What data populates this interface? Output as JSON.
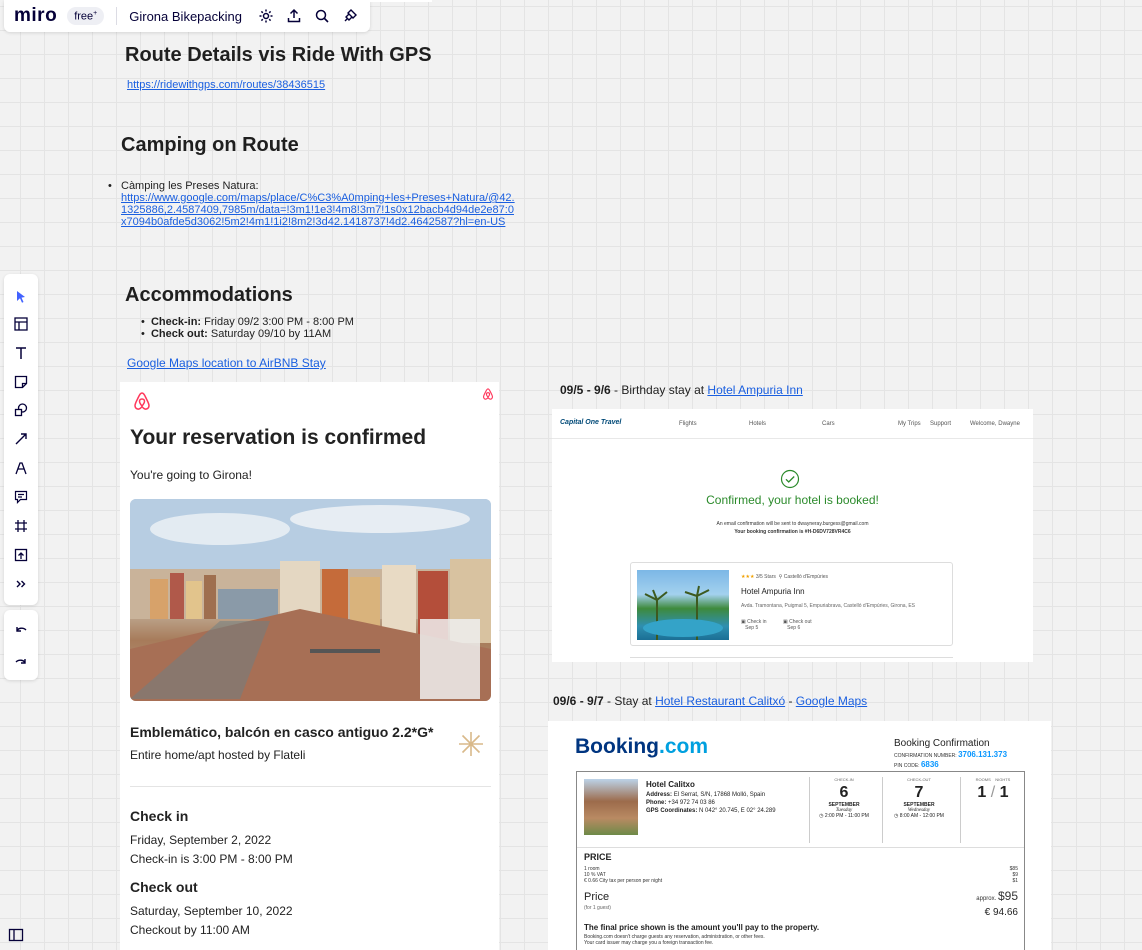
{
  "app": {
    "logo": "miro",
    "plan_badge": "free",
    "board_name": "Girona Bikepacking"
  },
  "board": {
    "route_title": "Route Details vis Ride With GPS",
    "route_link": "https://ridewithgps.com/routes/38436515",
    "camping_title": "Camping on Route",
    "camping_item_name": "Càmping les Preses Natura:",
    "camping_link_lines": [
      "https://www.google.com/maps/place/C%C3%A0mping+les+Preses+Natura/@42.",
      "1325886,2.4587409,7985m/data=!3m1!1e3!4m8!3m7!1s0x12bacb4d94de2e87:0",
      "x7094b0afde5d3062!5m2!4m1!1i2!8m2!3d42.1418737!4d2.4642587?hl=en-US"
    ],
    "accommodations_title": "Accommodations",
    "checkin_label": "Check-in:",
    "checkin_value": "Friday 09/2 3:00 PM - 8:00 PM",
    "checkout_label": "Check out:",
    "checkout_value": "Saturday 09/10 by 11AM",
    "maps_link": "Google Maps location to AirBNB Stay"
  },
  "airbnb": {
    "title": "Your reservation is confirmed",
    "subtitle": "You're going to Girona!",
    "listing": "Emblemático, balcón en casco antiguo 2.2*G*",
    "host": "Entire home/apt hosted by Flateli",
    "checkin_h": "Check in",
    "checkin_date": "Friday, September 2, 2022",
    "checkin_time": "Check-in is 3:00 PM - 8:00 PM",
    "checkout_h": "Check out",
    "checkout_date": "Saturday, September 10, 2022",
    "checkout_time": "Checkout by 11:00 AM"
  },
  "stay1": {
    "dates": "09/5 - 9/6",
    "text": " - Birthday stay at ",
    "link": "Hotel Ampuria Inn"
  },
  "capitalone": {
    "logo": "Capital One Travel",
    "nav": [
      "Flights",
      "Hotels",
      "Cars"
    ],
    "nav_right": [
      "My Trips",
      "Support",
      "Welcome, Dwayne"
    ],
    "title": "Confirmed, your hotel is booked!",
    "email_note": "An email confirmation will be sent to dwayneray.burgess@gmail.com",
    "conf_note": "Your booking confirmation is #H-D6DV728VR4C6",
    "stars": "3/5 Stars",
    "location": "Castelló d'Empúries",
    "hotel": "Hotel Ampuria Inn",
    "address": "Avda. Tramontana, Puigmal 5, Empuriabrava, Castelló d'Empúries, Girona, ES",
    "checkin_label": "Check in",
    "checkin": "Sep 5",
    "checkout_label": "Check out",
    "checkout": "Sep 6"
  },
  "stay2": {
    "dates": "09/6 - 9/7",
    "text": " - Stay at ",
    "link": "Hotel Restaurant Calitxó",
    "sep": " - ",
    "link2": "Google Maps"
  },
  "booking": {
    "logo_main": "Booking",
    "logo_dot": ".com",
    "heading": "Booking Confirmation",
    "conf_label": "CONFIRMATION NUMBER:",
    "conf_number": "3706.131.373",
    "pin_label": "PIN CODE:",
    "pin": "6836",
    "hotel": "Hotel Calitxo",
    "address_label": "Address:",
    "address": "El Serrat, S/N, 17868 Molló, Spain",
    "phone_label": "Phone:",
    "phone": "+34 972 74 03 86",
    "gps_label": "GPS Coordinates:",
    "gps": "N 042° 20.745, E 02° 24.289",
    "checkin_cap": "CHECK-IN",
    "checkin_day": "6",
    "checkin_month": "SEPTEMBER",
    "checkin_dow": "Tuesday",
    "checkin_time": "2:00 PM - 11:00 PM",
    "checkout_cap": "CHECK-OUT",
    "checkout_day": "7",
    "checkout_month": "SEPTEMBER",
    "checkout_dow": "Wednesday",
    "checkout_time": "8:00 AM - 12:00 PM",
    "rooms_cap": "ROOMS",
    "nights_cap": "NIGHTS",
    "rooms": "1",
    "nights": "1",
    "price_h": "PRICE",
    "price_lines": [
      {
        "label": "1 room",
        "value": "$85"
      },
      {
        "label": "10 % VAT",
        "value": "$9"
      },
      {
        "label": "€ 0.66 City tax per person per night",
        "value": "$1"
      }
    ],
    "price_label": "Price",
    "price_guest": "(for 1 guest)",
    "approx_label": "approx.",
    "approx_value": "$95",
    "eur_value": "€ 94.66",
    "final_note": "The final price shown is the amount you'll pay to the property.",
    "note1": "Booking.com doesn't charge guests any reservation, administration, or other fees.",
    "note2": "Your card issuer may charge you a foreign transaction fee."
  }
}
